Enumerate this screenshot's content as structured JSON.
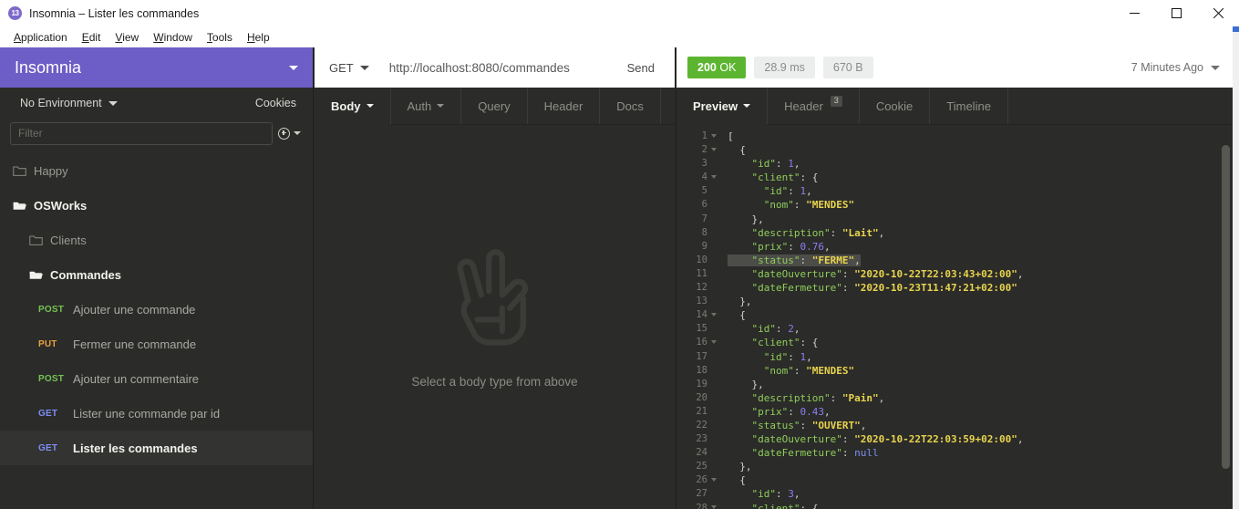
{
  "window": {
    "title": "Insomnia – Lister les commandes",
    "logo_text": "13",
    "controls": [
      {
        "name": "minimize",
        "label": "—"
      },
      {
        "name": "maximize",
        "label": "□"
      },
      {
        "name": "close",
        "label": "✕"
      }
    ]
  },
  "menubar": {
    "items": [
      {
        "mnemonic": "A",
        "rest": "pplication"
      },
      {
        "mnemonic": "E",
        "rest": "dit"
      },
      {
        "mnemonic": "V",
        "rest": "iew"
      },
      {
        "mnemonic": "W",
        "rest": "indow"
      },
      {
        "mnemonic": "T",
        "rest": "ools"
      },
      {
        "mnemonic": "H",
        "rest": "elp"
      }
    ]
  },
  "sidebar": {
    "workspace_name": "Insomnia",
    "environment_label": "No Environment",
    "cookies_label": "Cookies",
    "filter_placeholder": "Filter",
    "filter_value": "",
    "tree": [
      {
        "type": "folder",
        "label": "Happy",
        "open": false,
        "depth": 0,
        "selected": false
      },
      {
        "type": "folder",
        "label": "OSWorks",
        "open": true,
        "depth": 0,
        "selected": false
      },
      {
        "type": "folder",
        "label": "Clients",
        "open": false,
        "depth": 1,
        "selected": false
      },
      {
        "type": "folder",
        "label": "Commandes",
        "open": true,
        "depth": 1,
        "selected": false
      },
      {
        "type": "request",
        "method": "POST",
        "label": "Ajouter une commande",
        "depth": 2,
        "selected": false
      },
      {
        "type": "request",
        "method": "PUT",
        "label": "Fermer une commande",
        "depth": 2,
        "selected": false
      },
      {
        "type": "request",
        "method": "POST",
        "label": "Ajouter un commentaire",
        "depth": 2,
        "selected": false
      },
      {
        "type": "request",
        "method": "GET",
        "label": "Lister une commande par id",
        "depth": 2,
        "selected": false
      },
      {
        "type": "request",
        "method": "GET",
        "label": "Lister les commandes",
        "depth": 2,
        "selected": true
      }
    ]
  },
  "request": {
    "method": "GET",
    "url": "http://localhost:8080/commandes",
    "send_label": "Send",
    "tabs": [
      {
        "label": "Body",
        "active": true,
        "caret": true,
        "badge": null
      },
      {
        "label": "Auth",
        "active": false,
        "caret": true,
        "badge": null
      },
      {
        "label": "Query",
        "active": false,
        "caret": false,
        "badge": null
      },
      {
        "label": "Header",
        "active": false,
        "caret": false,
        "badge": null
      },
      {
        "label": "Docs",
        "active": false,
        "caret": false,
        "badge": null
      }
    ],
    "empty_body_text": "Select a body type from above"
  },
  "response": {
    "status_code": "200",
    "status_text": "OK",
    "time": "28.9 ms",
    "size": "670 B",
    "timeago": "7 Minutes Ago",
    "tabs": [
      {
        "label": "Preview",
        "active": true,
        "caret": true,
        "badge": null
      },
      {
        "label": "Header",
        "active": false,
        "caret": false,
        "badge": "3"
      },
      {
        "label": "Cookie",
        "active": false,
        "caret": false,
        "badge": null
      },
      {
        "label": "Timeline",
        "active": false,
        "caret": false,
        "badge": null
      }
    ],
    "body_lines": [
      {
        "n": 1,
        "fold": true,
        "indent": 0,
        "tokens": [
          {
            "t": "p",
            "v": "["
          }
        ]
      },
      {
        "n": 2,
        "fold": true,
        "indent": 1,
        "tokens": [
          {
            "t": "p",
            "v": "{"
          }
        ]
      },
      {
        "n": 3,
        "fold": false,
        "indent": 2,
        "tokens": [
          {
            "t": "k",
            "v": "\"id\""
          },
          {
            "t": "p",
            "v": ": "
          },
          {
            "t": "n",
            "v": "1"
          },
          {
            "t": "p",
            "v": ","
          }
        ]
      },
      {
        "n": 4,
        "fold": true,
        "indent": 2,
        "tokens": [
          {
            "t": "k",
            "v": "\"client\""
          },
          {
            "t": "p",
            "v": ": {"
          }
        ]
      },
      {
        "n": 5,
        "fold": false,
        "indent": 3,
        "tokens": [
          {
            "t": "k",
            "v": "\"id\""
          },
          {
            "t": "p",
            "v": ": "
          },
          {
            "t": "n",
            "v": "1"
          },
          {
            "t": "p",
            "v": ","
          }
        ]
      },
      {
        "n": 6,
        "fold": false,
        "indent": 3,
        "tokens": [
          {
            "t": "k",
            "v": "\"nom\""
          },
          {
            "t": "p",
            "v": ": "
          },
          {
            "t": "s",
            "v": "\"MENDES\""
          }
        ]
      },
      {
        "n": 7,
        "fold": false,
        "indent": 2,
        "tokens": [
          {
            "t": "p",
            "v": "},"
          }
        ]
      },
      {
        "n": 8,
        "fold": false,
        "indent": 2,
        "tokens": [
          {
            "t": "k",
            "v": "\"description\""
          },
          {
            "t": "p",
            "v": ": "
          },
          {
            "t": "s",
            "v": "\"Lait\""
          },
          {
            "t": "p",
            "v": ","
          }
        ]
      },
      {
        "n": 9,
        "fold": false,
        "indent": 2,
        "tokens": [
          {
            "t": "k",
            "v": "\"prix\""
          },
          {
            "t": "p",
            "v": ": "
          },
          {
            "t": "n",
            "v": "0.76"
          },
          {
            "t": "p",
            "v": ","
          }
        ]
      },
      {
        "n": 10,
        "fold": false,
        "indent": 2,
        "highlight": true,
        "tokens": [
          {
            "t": "k",
            "v": "\"status\""
          },
          {
            "t": "p",
            "v": ": "
          },
          {
            "t": "s",
            "v": "\"FERME\""
          },
          {
            "t": "p",
            "v": ","
          }
        ]
      },
      {
        "n": 11,
        "fold": false,
        "indent": 2,
        "tokens": [
          {
            "t": "k",
            "v": "\"dateOuverture\""
          },
          {
            "t": "p",
            "v": ": "
          },
          {
            "t": "s",
            "v": "\"2020-10-22T22:03:43+02:00\""
          },
          {
            "t": "p",
            "v": ","
          }
        ]
      },
      {
        "n": 12,
        "fold": false,
        "indent": 2,
        "tokens": [
          {
            "t": "k",
            "v": "\"dateFermeture\""
          },
          {
            "t": "p",
            "v": ": "
          },
          {
            "t": "s",
            "v": "\"2020-10-23T11:47:21+02:00\""
          }
        ]
      },
      {
        "n": 13,
        "fold": false,
        "indent": 1,
        "tokens": [
          {
            "t": "p",
            "v": "},"
          }
        ]
      },
      {
        "n": 14,
        "fold": true,
        "indent": 1,
        "tokens": [
          {
            "t": "p",
            "v": "{"
          }
        ]
      },
      {
        "n": 15,
        "fold": false,
        "indent": 2,
        "tokens": [
          {
            "t": "k",
            "v": "\"id\""
          },
          {
            "t": "p",
            "v": ": "
          },
          {
            "t": "n",
            "v": "2"
          },
          {
            "t": "p",
            "v": ","
          }
        ]
      },
      {
        "n": 16,
        "fold": true,
        "indent": 2,
        "tokens": [
          {
            "t": "k",
            "v": "\"client\""
          },
          {
            "t": "p",
            "v": ": {"
          }
        ]
      },
      {
        "n": 17,
        "fold": false,
        "indent": 3,
        "tokens": [
          {
            "t": "k",
            "v": "\"id\""
          },
          {
            "t": "p",
            "v": ": "
          },
          {
            "t": "n",
            "v": "1"
          },
          {
            "t": "p",
            "v": ","
          }
        ]
      },
      {
        "n": 18,
        "fold": false,
        "indent": 3,
        "tokens": [
          {
            "t": "k",
            "v": "\"nom\""
          },
          {
            "t": "p",
            "v": ": "
          },
          {
            "t": "s",
            "v": "\"MENDES\""
          }
        ]
      },
      {
        "n": 19,
        "fold": false,
        "indent": 2,
        "tokens": [
          {
            "t": "p",
            "v": "},"
          }
        ]
      },
      {
        "n": 20,
        "fold": false,
        "indent": 2,
        "tokens": [
          {
            "t": "k",
            "v": "\"description\""
          },
          {
            "t": "p",
            "v": ": "
          },
          {
            "t": "s",
            "v": "\"Pain\""
          },
          {
            "t": "p",
            "v": ","
          }
        ]
      },
      {
        "n": 21,
        "fold": false,
        "indent": 2,
        "tokens": [
          {
            "t": "k",
            "v": "\"prix\""
          },
          {
            "t": "p",
            "v": ": "
          },
          {
            "t": "n",
            "v": "0.43"
          },
          {
            "t": "p",
            "v": ","
          }
        ]
      },
      {
        "n": 22,
        "fold": false,
        "indent": 2,
        "tokens": [
          {
            "t": "k",
            "v": "\"status\""
          },
          {
            "t": "p",
            "v": ": "
          },
          {
            "t": "s",
            "v": "\"OUVERT\""
          },
          {
            "t": "p",
            "v": ","
          }
        ]
      },
      {
        "n": 23,
        "fold": false,
        "indent": 2,
        "tokens": [
          {
            "t": "k",
            "v": "\"dateOuverture\""
          },
          {
            "t": "p",
            "v": ": "
          },
          {
            "t": "s",
            "v": "\"2020-10-22T22:03:59+02:00\""
          },
          {
            "t": "p",
            "v": ","
          }
        ]
      },
      {
        "n": 24,
        "fold": false,
        "indent": 2,
        "tokens": [
          {
            "t": "k",
            "v": "\"dateFermeture\""
          },
          {
            "t": "p",
            "v": ": "
          },
          {
            "t": "nl",
            "v": "null"
          }
        ]
      },
      {
        "n": 25,
        "fold": false,
        "indent": 1,
        "tokens": [
          {
            "t": "p",
            "v": "},"
          }
        ]
      },
      {
        "n": 26,
        "fold": true,
        "indent": 1,
        "tokens": [
          {
            "t": "p",
            "v": "{"
          }
        ]
      },
      {
        "n": 27,
        "fold": false,
        "indent": 2,
        "tokens": [
          {
            "t": "k",
            "v": "\"id\""
          },
          {
            "t": "p",
            "v": ": "
          },
          {
            "t": "n",
            "v": "3"
          },
          {
            "t": "p",
            "v": ","
          }
        ]
      },
      {
        "n": 28,
        "fold": true,
        "indent": 2,
        "tokens": [
          {
            "t": "k",
            "v": "\"client\""
          },
          {
            "t": "p",
            "v": ": {"
          }
        ]
      }
    ]
  },
  "colors": {
    "accent_purple": "#6d5dc6",
    "status_green": "#5cb531",
    "method_post": "#74c353",
    "method_put": "#e8a33d",
    "method_get": "#7d8ef5",
    "json_key": "#8fce5b",
    "json_string": "#e8d44d",
    "json_number": "#8a7ff0"
  }
}
